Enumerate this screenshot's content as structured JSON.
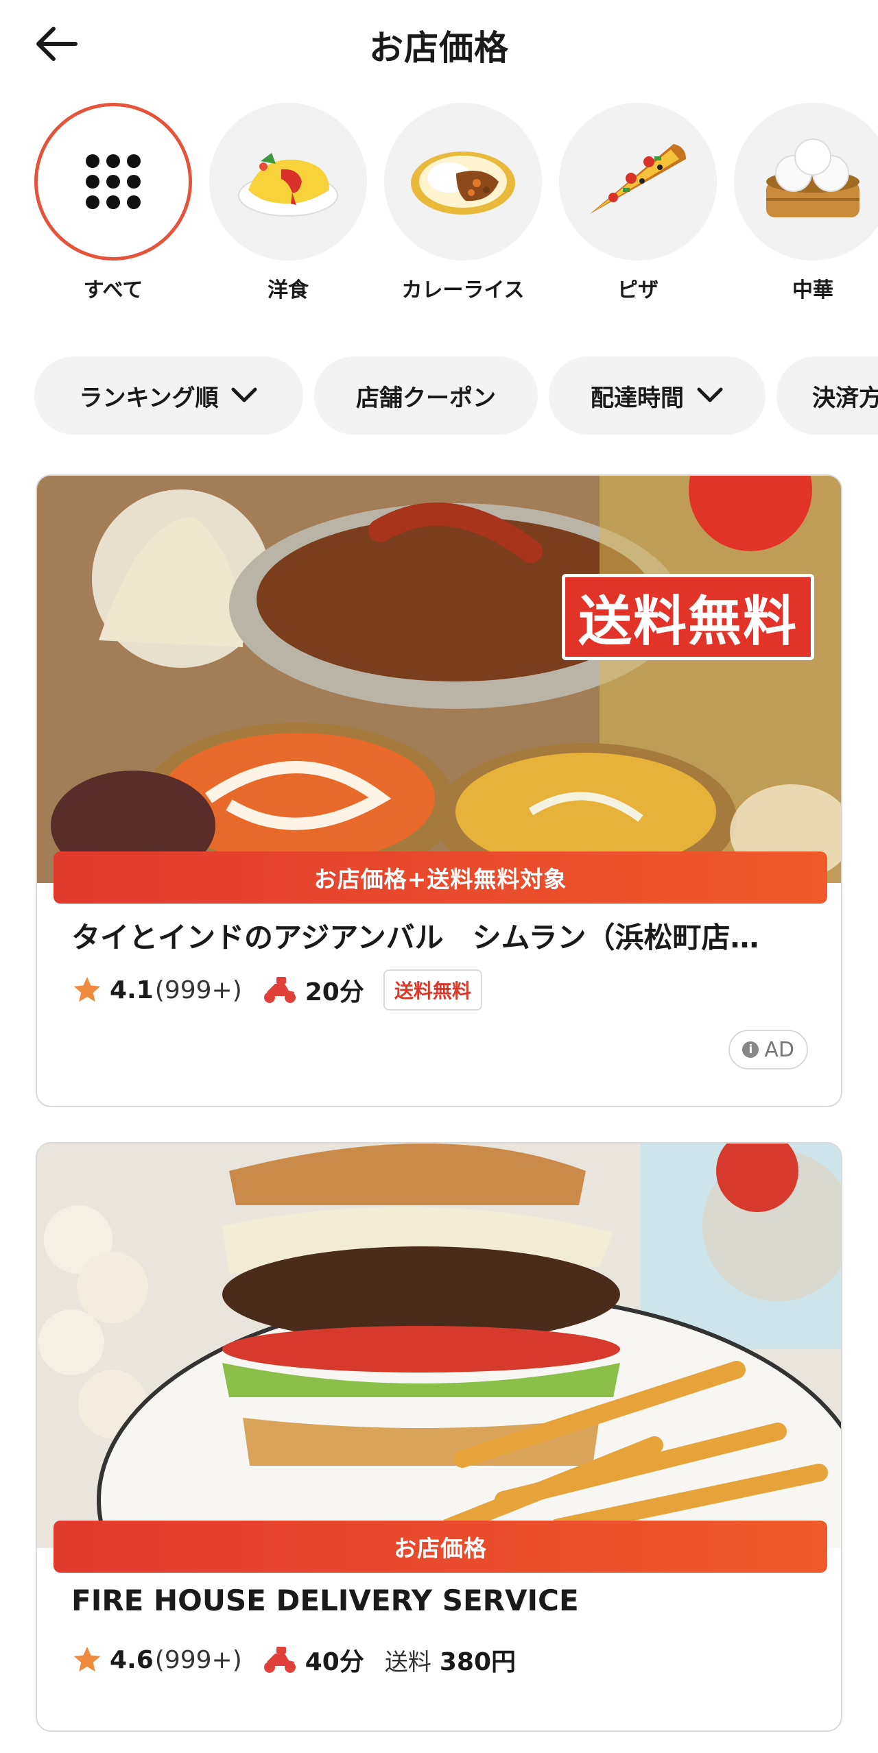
{
  "header": {
    "title": "お店価格",
    "back_icon": "arrow-left-icon"
  },
  "categories": [
    {
      "label": "すべて",
      "icon": "grid-dots-icon",
      "active": true
    },
    {
      "label": "洋食",
      "icon": "omelette-rice-icon",
      "active": false
    },
    {
      "label": "カレーライス",
      "icon": "curry-rice-icon",
      "active": false
    },
    {
      "label": "ピザ",
      "icon": "pizza-slice-icon",
      "active": false
    },
    {
      "label": "中華",
      "icon": "dim-sum-icon",
      "active": false
    }
  ],
  "filters": [
    {
      "label": "ランキング順",
      "has_dropdown": true
    },
    {
      "label": "店舗クーポン",
      "has_dropdown": false
    },
    {
      "label": "配達時間",
      "has_dropdown": true
    },
    {
      "label": "決済方",
      "has_dropdown": false
    }
  ],
  "stores": [
    {
      "image_stamp": "送料無料",
      "promo": "お店価格+送料無料対象",
      "name": "タイとインドのアジアンバル　シムラン（浜松町店…",
      "rating": "4.1",
      "review_count": "(999+)",
      "delivery_time": "20分",
      "delivery_badge": "送料無料",
      "ad_label": "AD"
    },
    {
      "promo": "お店価格",
      "name": "FIRE HOUSE DELIVERY SERVICE",
      "rating": "4.6",
      "review_count": "(999+)",
      "delivery_time": "40分",
      "fee_label": "送料",
      "fee_value": "380円"
    }
  ],
  "colors": {
    "accent": "#e5533a",
    "promo_gradient_start": "#e23b2e",
    "promo_gradient_end": "#ee5a2c",
    "star": "#f08a3c",
    "moto": "#e0403a"
  }
}
